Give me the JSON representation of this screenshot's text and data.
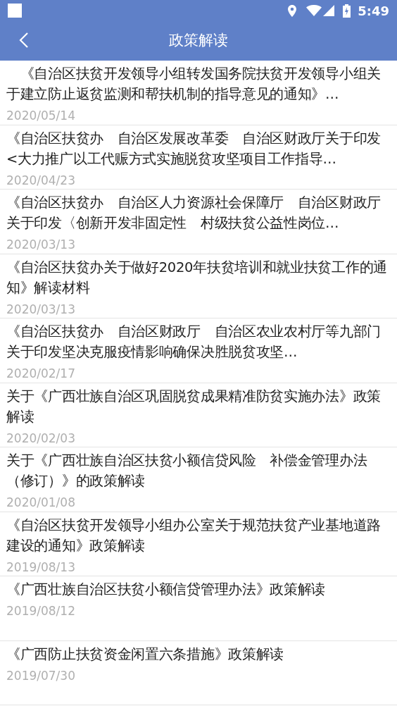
{
  "status_bar": {
    "time": "5:49"
  },
  "app_bar": {
    "title": "政策解读"
  },
  "items": [
    {
      "title": "　《自治区扶贫开发领导小组转发国务院扶贫开发领导小组关于建立防止返贫监测和帮扶机制的指导意见的通知》…",
      "date": "2020/05/14"
    },
    {
      "title": "《自治区扶贫办　自治区发展改革委　自治区财政厅关于印发<大力推广以工代赈方式实施脱贫攻坚项目工作指导…",
      "date": "2020/04/23"
    },
    {
      "title": "《自治区扶贫办　自治区人力资源社会保障厅　自治区财政厅关于印发〈创新开发非固定性　村级扶贫公益性岗位…",
      "date": "2020/03/13"
    },
    {
      "title": "《自治区扶贫办关于做好2020年扶贫培训和就业扶贫工作的通知》解读材料",
      "date": "2020/03/13"
    },
    {
      "title": "《自治区扶贫办　自治区财政厅　自治区农业农村厅等九部门关于印发坚决克服疫情影响确保决胜脱贫攻坚…",
      "date": "2020/02/17"
    },
    {
      "title": "关于《广西壮族自治区巩固脱贫成果精准防贫实施办法》政策解读",
      "date": "2020/02/03"
    },
    {
      "title": "关于《广西壮族自治区扶贫小额信贷风险　补偿金管理办法（修订）》的政策解读",
      "date": "2020/01/08"
    },
    {
      "title": "《自治区扶贫开发领导小组办公室关于规范扶贫产业基地道路建设的通知》政策解读",
      "date": "2019/08/13"
    },
    {
      "title": "《广西壮族自治区扶贫小额信贷管理办法》政策解读",
      "date": "2019/08/12"
    },
    {
      "title": "《广西防止扶贫资金闲置六条措施》政策解读",
      "date": "2019/07/30"
    }
  ]
}
